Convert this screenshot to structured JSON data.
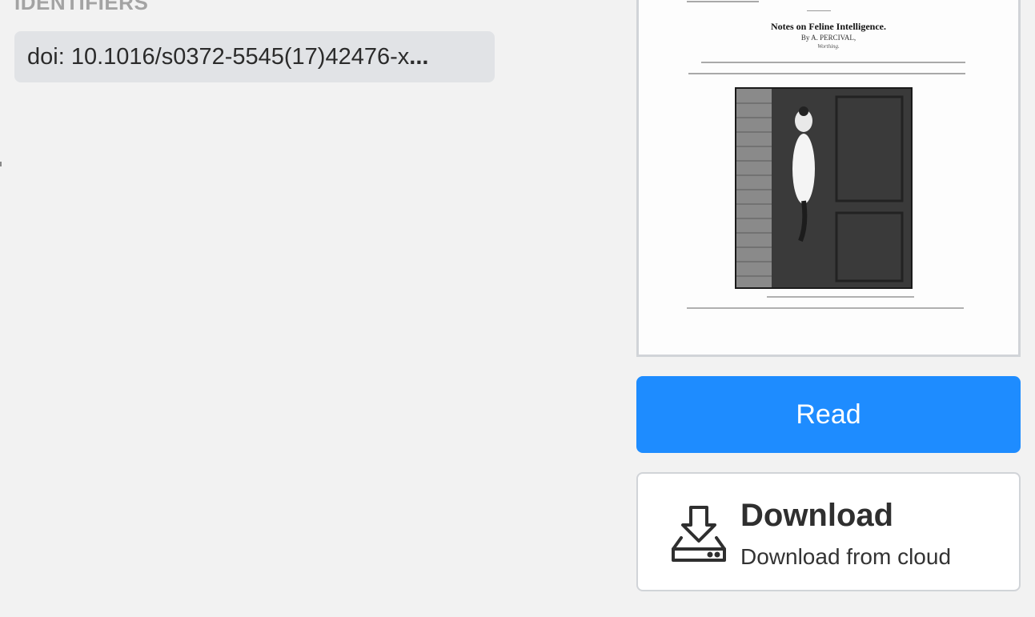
{
  "identifiers": {
    "heading": "IDENTIFIERS",
    "doi_text": "doi: 10.1016/s0372-5545(17)42476-x",
    "overflow_marker": "..."
  },
  "cover": {
    "article_title": "Notes on Feline Intelligence.",
    "byline": "By A. PERCIVAL,",
    "place": "Worthing."
  },
  "actions": {
    "read_label": "Read",
    "download_title": "Download",
    "download_subtitle": "Download from cloud",
    "download_icon": "download-tray-icon"
  },
  "colors": {
    "read_button": "#1e8cff",
    "background": "#f2f2f2",
    "chip": "#e1e3e6"
  }
}
